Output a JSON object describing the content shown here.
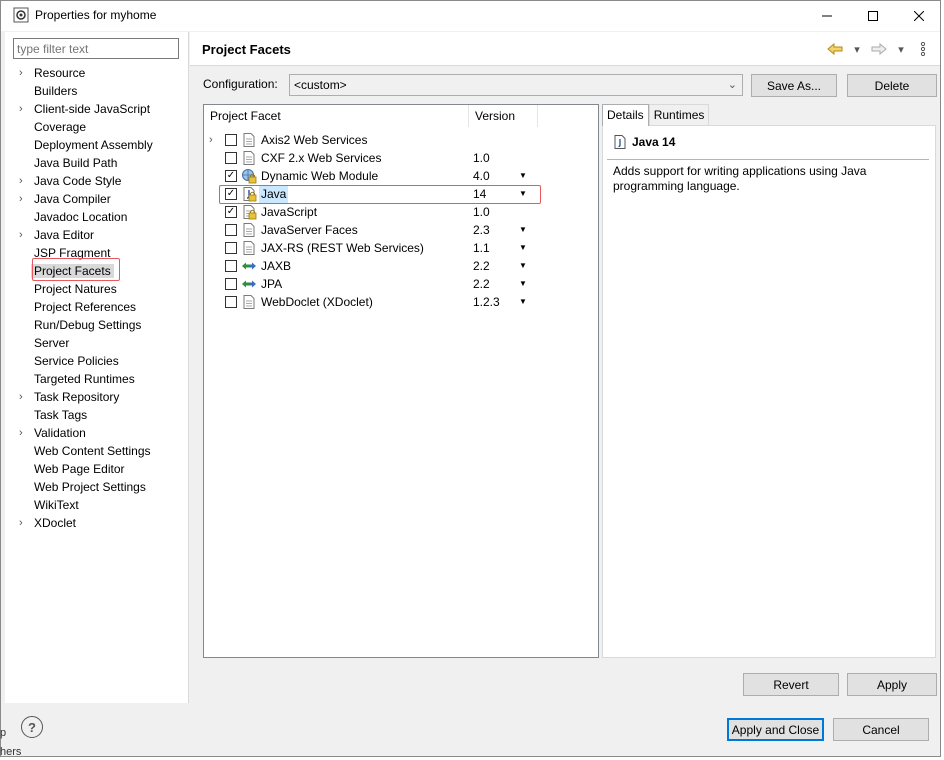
{
  "window": {
    "title": "Properties for myhome",
    "controls": {
      "minimize": "—",
      "maximize": "☐",
      "close": "✕"
    }
  },
  "sidebar": {
    "filter_placeholder": "type filter text",
    "items": [
      {
        "label": "Resource",
        "expandable": true
      },
      {
        "label": "Builders",
        "expandable": false
      },
      {
        "label": "Client-side JavaScript",
        "expandable": true
      },
      {
        "label": "Coverage",
        "expandable": false
      },
      {
        "label": "Deployment Assembly",
        "expandable": false
      },
      {
        "label": "Java Build Path",
        "expandable": false
      },
      {
        "label": "Java Code Style",
        "expandable": true
      },
      {
        "label": "Java Compiler",
        "expandable": true
      },
      {
        "label": "Javadoc Location",
        "expandable": false
      },
      {
        "label": "Java Editor",
        "expandable": true
      },
      {
        "label": "JSP Fragment",
        "expandable": false
      },
      {
        "label": "Project Facets",
        "expandable": false,
        "selected": true
      },
      {
        "label": "Project Natures",
        "expandable": false
      },
      {
        "label": "Project References",
        "expandable": false
      },
      {
        "label": "Run/Debug Settings",
        "expandable": false
      },
      {
        "label": "Server",
        "expandable": false
      },
      {
        "label": "Service Policies",
        "expandable": false
      },
      {
        "label": "Targeted Runtimes",
        "expandable": false
      },
      {
        "label": "Task Repository",
        "expandable": true
      },
      {
        "label": "Task Tags",
        "expandable": false
      },
      {
        "label": "Validation",
        "expandable": true
      },
      {
        "label": "Web Content Settings",
        "expandable": false
      },
      {
        "label": "Web Page Editor",
        "expandable": false
      },
      {
        "label": "Web Project Settings",
        "expandable": false
      },
      {
        "label": "WikiText",
        "expandable": false
      },
      {
        "label": "XDoclet",
        "expandable": true
      }
    ]
  },
  "page": {
    "title": "Project Facets",
    "config_label": "Configuration:",
    "config_value": "<custom>",
    "save_as": "Save As...",
    "delete": "Delete",
    "revert": "Revert",
    "apply": "Apply",
    "apply_close": "Apply and Close",
    "cancel": "Cancel"
  },
  "facets": {
    "col_facet": "Project Facet",
    "col_version": "Version",
    "rows": [
      {
        "name": "Axis2 Web Services",
        "version": "",
        "checked": false,
        "expander": true,
        "icon": "page",
        "dropdown": false
      },
      {
        "name": "CXF 2.x Web Services",
        "version": "1.0",
        "checked": false,
        "expander": false,
        "icon": "page",
        "dropdown": false
      },
      {
        "name": "Dynamic Web Module",
        "version": "4.0",
        "checked": true,
        "expander": false,
        "icon": "web-lock",
        "dropdown": true
      },
      {
        "name": "Java",
        "version": "14",
        "checked": true,
        "expander": false,
        "icon": "java-lock",
        "dropdown": true,
        "selected": true
      },
      {
        "name": "JavaScript",
        "version": "1.0",
        "checked": true,
        "expander": false,
        "icon": "page-lock",
        "dropdown": false
      },
      {
        "name": "JavaServer Faces",
        "version": "2.3",
        "checked": false,
        "expander": false,
        "icon": "page",
        "dropdown": true
      },
      {
        "name": "JAX-RS (REST Web Services)",
        "version": "1.1",
        "checked": false,
        "expander": false,
        "icon": "page",
        "dropdown": true
      },
      {
        "name": "JAXB",
        "version": "2.2",
        "checked": false,
        "expander": false,
        "icon": "arrows",
        "dropdown": true
      },
      {
        "name": "JPA",
        "version": "2.2",
        "checked": false,
        "expander": false,
        "icon": "arrows",
        "dropdown": true
      },
      {
        "name": "WebDoclet (XDoclet)",
        "version": "1.2.3",
        "checked": false,
        "expander": false,
        "icon": "page",
        "dropdown": true
      }
    ]
  },
  "details": {
    "tab_details": "Details",
    "tab_runtimes": "Runtimes",
    "title": "Java 14",
    "description": "Adds support for writing applications using Java programming language."
  },
  "background_fragments": {
    "a": "p",
    "b": "hers"
  }
}
